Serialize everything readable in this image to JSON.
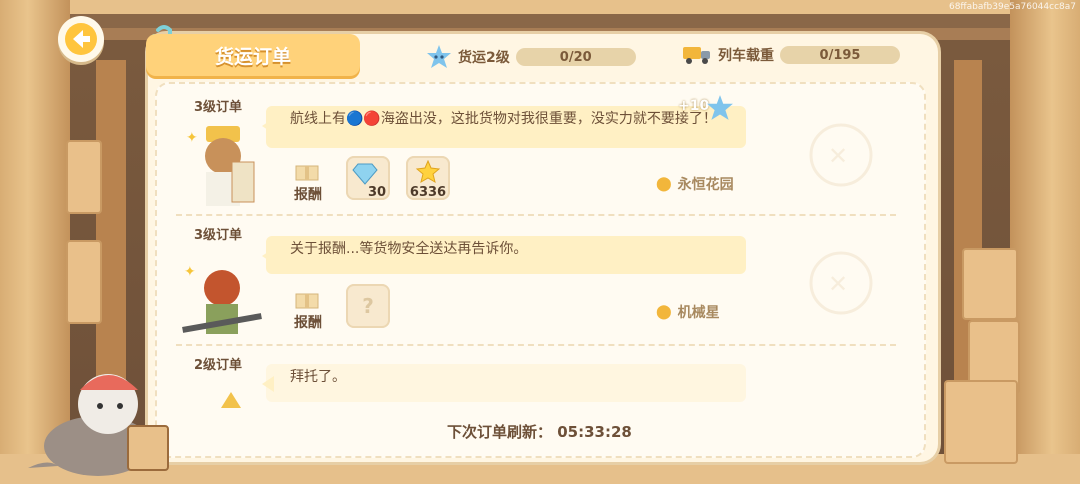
{
  "watermark": "68ffabafb39e5a76044cc8a7",
  "header": {
    "title": "货运订单"
  },
  "stats": {
    "cargo_level_label": "货运2级",
    "cargo_progress": "0/20",
    "train_load_label": "列车载重",
    "train_load_value": "0/195"
  },
  "orders": [
    {
      "level": "3级订单",
      "message": "航线上有🔵🔴海盗出没，这批货物对我很重要，没实力就不要接了！",
      "bonus": "+10",
      "reward_label": "报酬",
      "rewards": [
        {
          "icon": "diamond-icon",
          "amount": "30"
        },
        {
          "icon": "star-icon",
          "amount": "6336"
        }
      ],
      "destination": "永恒花园"
    },
    {
      "level": "3级订单",
      "message": "关于报酬...等货物安全送达再告诉你。",
      "reward_label": "报酬",
      "rewards": [
        {
          "icon": "unknown-reward-icon",
          "amount": "?"
        }
      ],
      "destination": "机械星"
    },
    {
      "level": "2级订单",
      "message": "拜托了。"
    }
  ],
  "footer": {
    "refresh_label": "下次订单刷新：",
    "refresh_time": "05:33:28"
  },
  "colors": {
    "accent": "#ffd27a",
    "panel": "#fff6e3",
    "text": "#6d5038"
  }
}
